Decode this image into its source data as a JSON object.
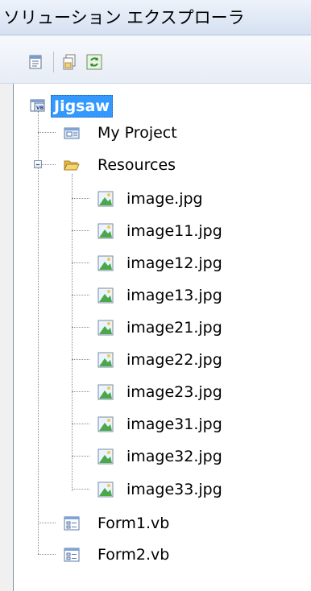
{
  "panel": {
    "title": "ソリューション エクスプローラ"
  },
  "toolbar": {
    "buttons": [
      {
        "name": "properties",
        "icon": "properties-icon"
      },
      {
        "name": "show-all-files",
        "icon": "show-all-files-icon"
      },
      {
        "name": "refresh",
        "icon": "refresh-icon"
      }
    ]
  },
  "tree": {
    "root": {
      "label": "Jigsaw",
      "icon": "vb-project-icon",
      "selected": true
    },
    "my_project": {
      "label": "My Project",
      "icon": "my-project-icon"
    },
    "resources": {
      "label": "Resources",
      "icon": "folder-open-icon",
      "expanded": true
    },
    "files": [
      {
        "label": "image.jpg"
      },
      {
        "label": "image11.jpg"
      },
      {
        "label": "image12.jpg"
      },
      {
        "label": "image13.jpg"
      },
      {
        "label": "image21.jpg"
      },
      {
        "label": "image22.jpg"
      },
      {
        "label": "image23.jpg"
      },
      {
        "label": "image31.jpg"
      },
      {
        "label": "image32.jpg"
      },
      {
        "label": "image33.jpg"
      }
    ],
    "forms": [
      {
        "label": "Form1.vb",
        "icon": "form-icon"
      },
      {
        "label": "Form2.vb",
        "icon": "form-icon"
      }
    ]
  },
  "colors": {
    "selection": "#3399ff",
    "title_gradient_top": "#eef3fb",
    "title_gradient_bottom": "#d5e0f1"
  }
}
